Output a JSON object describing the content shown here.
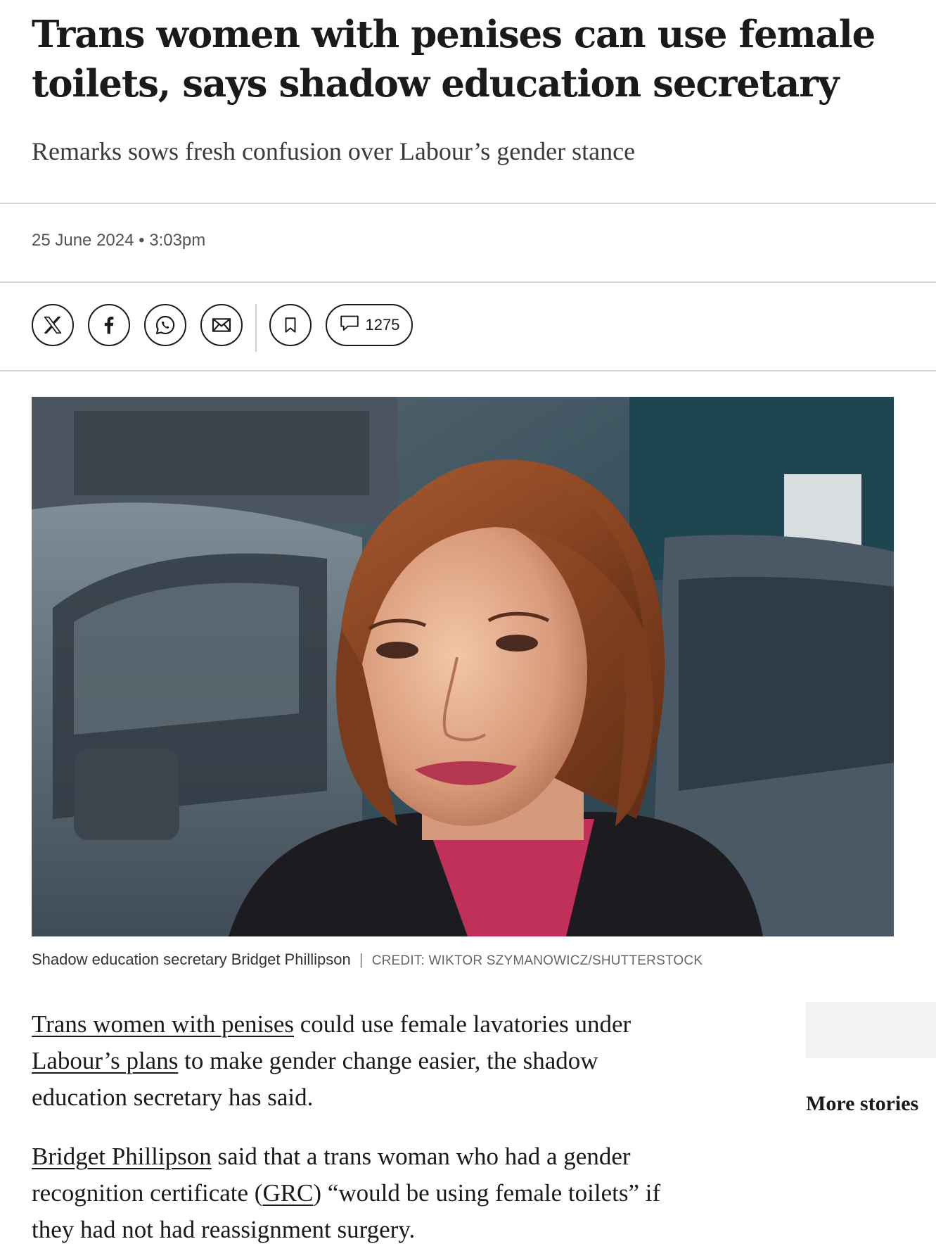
{
  "article": {
    "headline": "Trans women with penises can use female toilets, says shadow education secretary",
    "standfirst": "Remarks sows fresh confusion over Labour’s gender stance",
    "date": "25 June 2024",
    "separator": "•",
    "time": "3:03pm"
  },
  "share": {
    "buttons": [
      {
        "icon": "x-logo-icon"
      },
      {
        "icon": "facebook-icon"
      },
      {
        "icon": "whatsapp-icon"
      },
      {
        "icon": "email-icon"
      }
    ],
    "bookmark_icon": "bookmark-icon",
    "comments_icon": "comment-icon",
    "comments_count": "1275"
  },
  "image": {
    "caption": "Shadow education secretary Bridget Phillipson",
    "caption_separator": "|",
    "credit": "CREDIT: WIKTOR SZYMANOWICZ/SHUTTERSTOCK"
  },
  "body": {
    "p1": {
      "link1": "Trans women with penises",
      "text1": " could use female lavatories under ",
      "link2": "Labour’s plans",
      "text2": " to make gender change easier, the shadow education secretary has said."
    },
    "p2": {
      "link1": "Bridget Phillipson",
      "text1": " said that a trans woman who had a gender recognition certificate (",
      "link2": "GRC",
      "text2": ") “would be using female toilets” if they had not had reassignment surgery."
    }
  },
  "sidebar": {
    "more_stories": "More stories"
  },
  "colors": {
    "text": "#1a1a1a",
    "muted": "#555555",
    "rule": "#d6d6d6"
  }
}
